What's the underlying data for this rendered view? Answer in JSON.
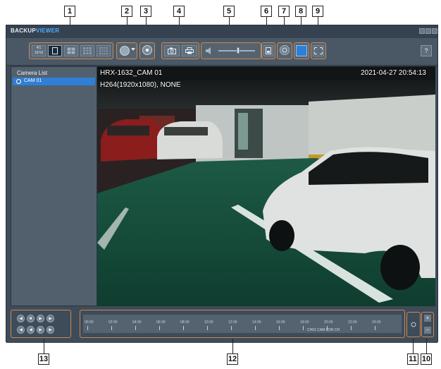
{
  "app": {
    "title_main": "BACKUP",
    "title_accent": "VIEWER"
  },
  "callouts": [
    "1",
    "2",
    "3",
    "4",
    "5",
    "6",
    "7",
    "8",
    "9",
    "10",
    "11",
    "12",
    "13"
  ],
  "toolbar": {
    "layout_count_label": "4/1",
    "layout_count_sub": "16/16",
    "help_label": "?"
  },
  "sidebar": {
    "title": "Camera List",
    "items": [
      {
        "label": "CAM 01",
        "selected": true
      }
    ]
  },
  "video": {
    "overlay_left": "HRX-1632_CAM 01",
    "overlay_date": "2021-04-27 20:54:13",
    "overlay_codec": "H264(1920x1080), NONE"
  },
  "timeline": {
    "ticks": [
      "00:00",
      "02:00",
      "04:00",
      "06:00",
      "08:00",
      "10:00",
      "12:00",
      "14:00",
      "16:00",
      "18:00",
      "20:00",
      "22:00",
      "24:00"
    ],
    "status": "CH01 CAM CDR CH"
  },
  "colors": {
    "accent": "#2f7fd6",
    "title_accent": "#4ab0ff",
    "callout_border": "#c98a5a",
    "window_bg": "#3e4b58"
  }
}
